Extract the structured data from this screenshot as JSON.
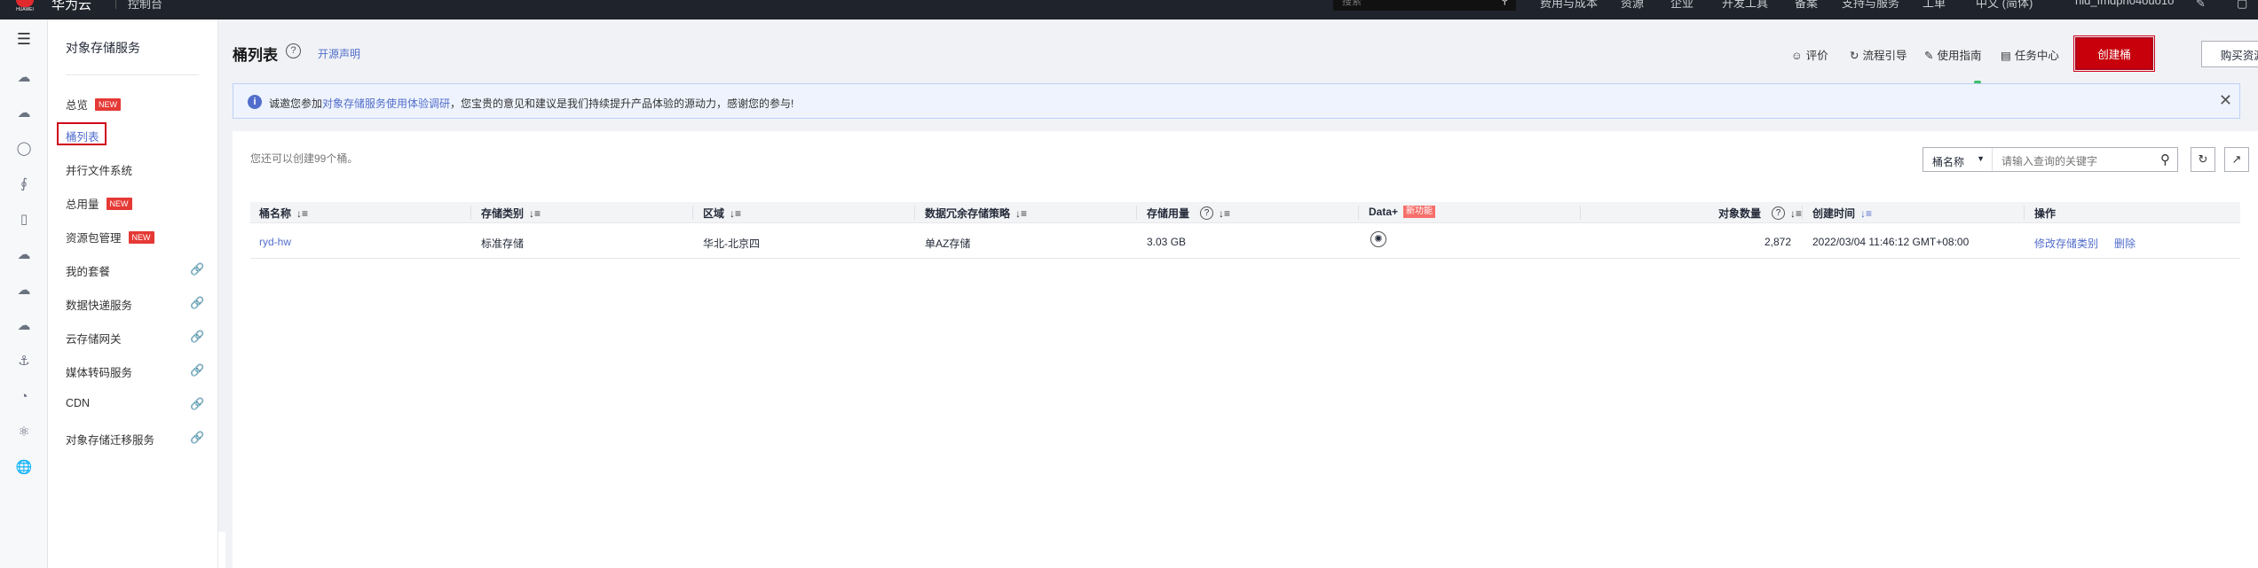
{
  "topbar": {
    "brand": "华为云",
    "console": "控制台",
    "search_placeholder": "搜索",
    "nav": [
      "费用与成本",
      "资源",
      "企业",
      "开发工具",
      "备案",
      "支持与服务",
      "工单",
      "中文 (简体)",
      "hid_fmdph04ouo1o"
    ]
  },
  "sidebar": {
    "title": "对象存储服务",
    "items": [
      {
        "label": "总览",
        "badge": "NEW"
      },
      {
        "label": "桶列表",
        "badge": ""
      },
      {
        "label": "并行文件系统",
        "badge": ""
      },
      {
        "label": "总用量",
        "badge": "NEW"
      },
      {
        "label": "资源包管理",
        "badge": "NEW"
      },
      {
        "label": "我的套餐",
        "badge": ""
      },
      {
        "label": "数据快递服务",
        "badge": ""
      },
      {
        "label": "云存储网关",
        "badge": ""
      },
      {
        "label": "媒体转码服务",
        "badge": ""
      },
      {
        "label": "CDN",
        "badge": ""
      },
      {
        "label": "对象存储迁移服务",
        "badge": ""
      }
    ]
  },
  "header": {
    "title": "桶列表",
    "help": "?",
    "open_source": "开源声明",
    "toolbar": [
      "评价",
      "流程引导",
      "使用指南",
      "任务中心"
    ],
    "create_button": "创建桶",
    "buy_button": "购买资源包"
  },
  "notice": {
    "prefix": "诚邀您参加",
    "link": "对象存储服务使用体验调研",
    "suffix": "，您宝贵的意见和建议是我们持续提升产品体验的源动力，感谢您的参与!"
  },
  "list": {
    "caption": "您还可以创建99个桶。",
    "filter_select": "桶名称",
    "search_placeholder": "请输入查询的关键字",
    "columns": {
      "name": "桶名称",
      "storage_class": "存储类别",
      "region": "区域",
      "redundancy": "数据冗余存储策略",
      "usage": "存储用量",
      "dataplus": "Data+",
      "dataplus_badge": "新功能",
      "objects": "对象数量",
      "created": "创建时间",
      "ops": "操作"
    },
    "rows": [
      {
        "name": "ryd-hw",
        "storage_class": "标准存储",
        "region": "华北-北京四",
        "redundancy": "单AZ存储",
        "usage": "3.03 GB",
        "objects": "2,872",
        "created": "2022/03/04 11:46:12 GMT+08:00",
        "op_modify": "修改存储类别",
        "op_delete": "删除"
      }
    ]
  }
}
